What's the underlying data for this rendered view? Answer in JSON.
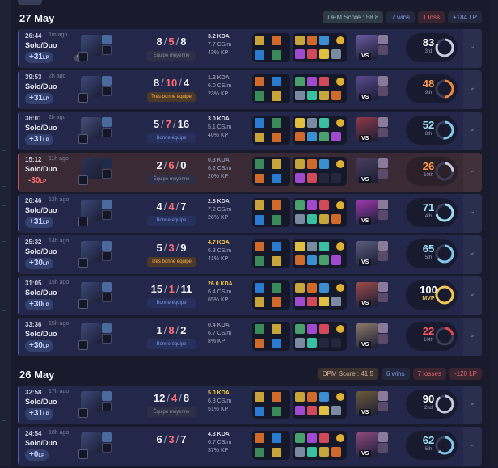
{
  "colors": {
    "win_bg": "#23284a",
    "loss_bg": "#3a2a35",
    "accent_blue": "#4a5eb8",
    "accent_red": "#c4505c"
  },
  "days": [
    {
      "date": "27 May",
      "dpm": "DPM Score : 58.8",
      "wins": "7 wins",
      "losses": "1 loss",
      "lp_delta": "+184 LP",
      "lp_delta_sign": "plus",
      "matches": [
        {
          "time": "26:44",
          "ago": "1m ago",
          "queue": "Solo/Duo",
          "lp": "+31",
          "lp_unit": "LP",
          "result": "win",
          "k": "8",
          "d": "5",
          "a": "8",
          "tag": "Équipe moyenne",
          "tag_style": "gray",
          "kda_ratio": "3.2 KDA",
          "kda_style": "normal",
          "cs": "7.7 CS/m",
          "kp": "43% KP",
          "score": "83",
          "rank": "3rd",
          "score_color": "#ffffff",
          "ring_pct": 0.83,
          "ring_color": "#c9cbe0",
          "champ_color": "#3d4a7a",
          "opp_color": "#6b5a9e",
          "help_icon": "?"
        },
        {
          "time": "39:53",
          "ago": "2h ago",
          "queue": "Solo/Duo",
          "lp": "+31",
          "lp_unit": "LP",
          "result": "win",
          "k": "8",
          "d": "10",
          "a": "4",
          "tag": "Très bonne équipe",
          "tag_style": "gold",
          "kda_ratio": "1.2 KDA",
          "kda_style": "dim",
          "cs": "6.0 CS/m",
          "kp": "23% KP",
          "score": "48",
          "rank": "9th",
          "score_color": "#ff9a4a",
          "ring_pct": 0.48,
          "ring_color": "#f08a3a",
          "champ_color": "#3d4a7a",
          "opp_color": "#5a4a8e"
        },
        {
          "time": "36:01",
          "ago": "2h ago",
          "queue": "Solo/Duo",
          "lp": "+31",
          "lp_unit": "LP",
          "result": "win",
          "k": "5",
          "d": "7",
          "a": "16",
          "tag": "Bonne équipe",
          "tag_style": "blue",
          "kda_ratio": "3.0 KDA",
          "kda_style": "normal",
          "cs": "5.1 CS/m",
          "kp": "40% KP",
          "score": "52",
          "rank": "8th",
          "score_color": "#9fdcf2",
          "ring_pct": 0.52,
          "ring_color": "#7fc8e8",
          "champ_color": "#46527e",
          "opp_color": "#8e3a4a"
        },
        {
          "time": "15:12",
          "ago": "11h ago",
          "queue": "Solo/Duo",
          "lp": "-30",
          "lp_unit": "LP",
          "result": "loss",
          "k": "2",
          "d": "6",
          "a": "0",
          "tag": "Équipe moyenne",
          "tag_style": "gray",
          "kda_ratio": "0.3 KDA",
          "kda_style": "dim",
          "cs": "6.2 CS/m",
          "kp": "20% KP",
          "score": "26",
          "rank": "10th",
          "score_color": "#ff9a4a",
          "ring_pct": 0.26,
          "ring_color": "#c9cbe0",
          "champ_color": "#2f3354",
          "opp_color": "#4a3e5e"
        },
        {
          "time": "26:46",
          "ago": "12h ago",
          "queue": "Solo/Duo",
          "lp": "+31",
          "lp_unit": "LP",
          "result": "win",
          "k": "4",
          "d": "4",
          "a": "7",
          "tag": "Bonne équipe",
          "tag_style": "blue",
          "kda_ratio": "2.8 KDA",
          "kda_style": "normal",
          "cs": "7.2 CS/m",
          "kp": "26% KP",
          "score": "71",
          "rank": "4th",
          "score_color": "#9fdcf2",
          "ring_pct": 0.71,
          "ring_color": "#9fdcf2",
          "champ_color": "#3d4a7a",
          "opp_color": "#a03ab0"
        },
        {
          "time": "25:32",
          "ago": "14h ago",
          "queue": "Solo/Duo",
          "lp": "+30",
          "lp_unit": "LP",
          "result": "win",
          "k": "5",
          "d": "3",
          "a": "9",
          "tag": "Très bonne équipe",
          "tag_style": "gold",
          "kda_ratio": "4.7 KDA",
          "kda_style": "gold",
          "cs": "6.3 CS/m",
          "kp": "41% KP",
          "score": "65",
          "rank": "5th",
          "score_color": "#9fdcf2",
          "ring_pct": 0.65,
          "ring_color": "#7fc8e8",
          "champ_color": "#3d4a7a",
          "opp_color": "#5a5e7e"
        },
        {
          "time": "31:05",
          "ago": "15h ago",
          "queue": "Solo/Duo",
          "lp": "+30",
          "lp_unit": "LP",
          "result": "win",
          "k": "15",
          "d": "1",
          "a": "11",
          "tag": "Bonne équipe",
          "tag_style": "blue",
          "kda_ratio": "26.0 KDA",
          "kda_style": "gold",
          "cs": "6.4 CS/m",
          "kp": "65% KP",
          "score": "100",
          "rank": "MVP",
          "score_color": "#ffffff",
          "ring_pct": 1.0,
          "ring_color": "#f4c752",
          "champ_color": "#3d4a7a",
          "opp_color": "#9e4a4a"
        },
        {
          "time": "33:36",
          "ago": "15h ago",
          "queue": "Solo/Duo",
          "lp": "+30",
          "lp_unit": "LP",
          "result": "win",
          "k": "1",
          "d": "8",
          "a": "2",
          "tag": "Bonne équipe",
          "tag_style": "blue",
          "kda_ratio": "0.4 KDA",
          "kda_style": "dim",
          "cs": "6.7 CS/m",
          "kp": "8% KP",
          "score": "22",
          "rank": "10th",
          "score_color": "#ff5a62",
          "ring_pct": 0.22,
          "ring_color": "#e8444c",
          "champ_color": "#3d4a7a",
          "opp_color": "#8e7a6a"
        }
      ]
    },
    {
      "date": "26 May",
      "dpm": "DPM Score : 41.5",
      "wins": "6 wins",
      "losses": "7 losses",
      "lp_delta": "-120 LP",
      "lp_delta_sign": "minus",
      "matches": [
        {
          "time": "32:58",
          "ago": "17h ago",
          "queue": "Solo/Duo",
          "lp": "+31",
          "lp_unit": "LP",
          "result": "win",
          "k": "12",
          "d": "4",
          "a": "8",
          "tag": "Équipe moyenne",
          "tag_style": "gray",
          "kda_ratio": "5.0 KDA",
          "kda_style": "gold",
          "cs": "6.3 CS/m",
          "kp": "51% KP",
          "score": "90",
          "rank": "2nd",
          "score_color": "#ffffff",
          "ring_pct": 0.9,
          "ring_color": "#c9cbe0",
          "champ_color": "#3d4a7a",
          "opp_color": "#6e5a3a"
        },
        {
          "time": "24:54",
          "ago": "18h ago",
          "queue": "Solo/Duo",
          "lp": "+0",
          "lp_unit": "LP",
          "result": "win",
          "k": "6",
          "d": "3",
          "a": "7",
          "tag": "",
          "tag_style": "gray",
          "kda_ratio": "4.3 KDA",
          "kda_style": "normal",
          "cs": "6.7 CS/m",
          "kp": "37% KP",
          "score": "62",
          "rank": "5th",
          "score_color": "#9fdcf2",
          "ring_pct": 0.62,
          "ring_color": "#7fc8e8",
          "champ_color": "#3d4a7a",
          "opp_color": "#8e4a7e"
        }
      ]
    }
  ],
  "icons": {
    "queue_help": "question-icon",
    "expand": "chevron-down-icon",
    "vs": "VS"
  }
}
